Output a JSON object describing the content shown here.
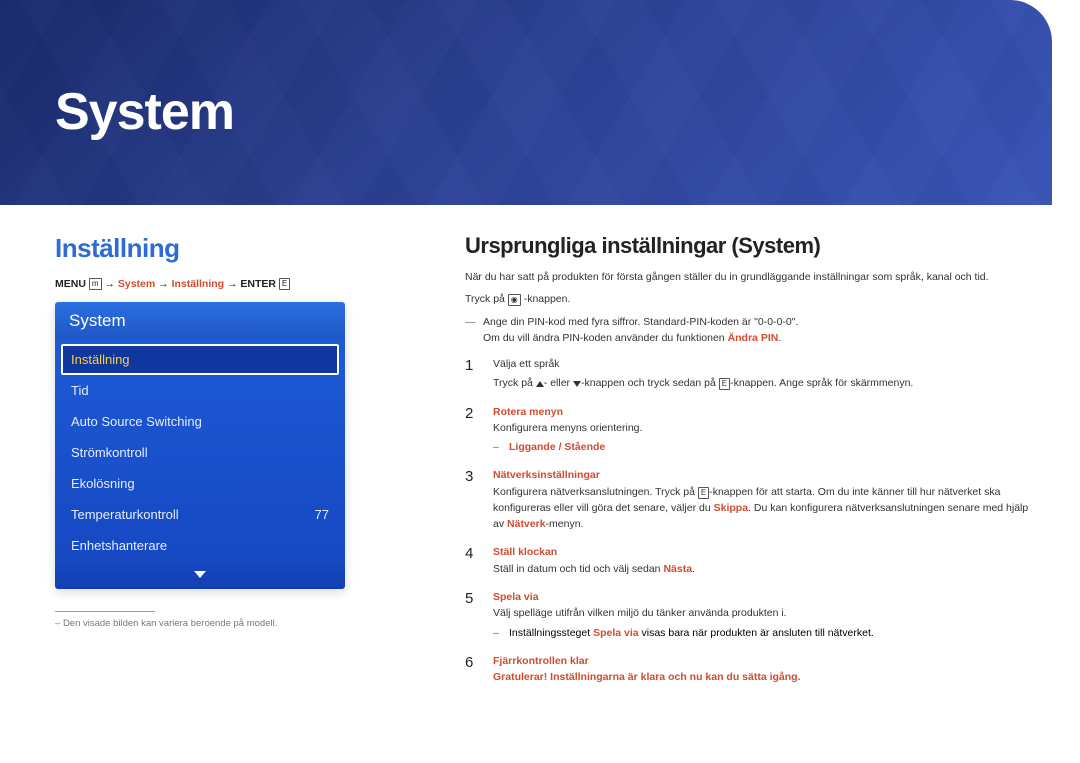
{
  "banner": {
    "title": "System"
  },
  "left": {
    "section_title": "Inställning",
    "breadcrumb": {
      "menu": "MENU",
      "arrow": "→",
      "p1": "System",
      "p2": "Inställning",
      "enter": "ENTER"
    },
    "menu": {
      "header": "System",
      "items": [
        {
          "label": "Inställning",
          "value": "",
          "selected": true
        },
        {
          "label": "Tid",
          "value": ""
        },
        {
          "label": "Auto Source Switching",
          "value": ""
        },
        {
          "label": "Strömkontroll",
          "value": ""
        },
        {
          "label": "Ekolösning",
          "value": ""
        },
        {
          "label": "Temperaturkontroll",
          "value": "77"
        },
        {
          "label": "Enhetshanterare",
          "value": ""
        }
      ]
    },
    "footnote_prefix": "–",
    "footnote": "Den visade bilden kan variera beroende på modell."
  },
  "right": {
    "title": "Ursprungliga inställningar (System)",
    "intro1": "När du har satt på produkten för första gången ställer du in grundläggande inställningar som språk, kanal och tid.",
    "intro2a": "Tryck på ",
    "intro2b": " -knappen.",
    "note1a": "Ange din PIN-kod med fyra siffror. Standard-PIN-koden är \"0-0-0-0\".",
    "note1b_pre": "Om du vill ändra PIN-koden använder du funktionen ",
    "note1b_hl": "Ändra PIN",
    "note1b_post": ".",
    "steps": {
      "s1": {
        "head": "Välja ett språk",
        "sub_a": "Tryck på ",
        "sub_b": "- eller ",
        "sub_c": "-knappen och tryck sedan på ",
        "sub_d": "-knappen. Ange språk för skärmmenyn."
      },
      "s2": {
        "head": "Rotera menyn",
        "sub": "Konfigurera menyns orientering.",
        "dash_hl": "Liggande / Stående"
      },
      "s3": {
        "head": "Nätverksinställningar",
        "sub_a": "Konfigurera nätverksanslutningen. Tryck på ",
        "sub_b": "-knappen för att starta. Om du inte känner till hur nätverket ska konfigureras eller vill göra det senare, väljer du ",
        "skip": "Skippa",
        "sub_c": ". Du kan konfigurera nätverksanslutningen senare med hjälp av ",
        "net": "Nätverk",
        "sub_d": "-menyn."
      },
      "s4": {
        "head": "Ställ klockan",
        "sub_a": "Ställ in datum och tid och välj sedan ",
        "nasta": "Nästa",
        "sub_b": "."
      },
      "s5": {
        "head": "Spela via",
        "sub": "Välj spelläge utifrån vilken miljö du tänker använda produkten i.",
        "dash_a": "Inställningssteget ",
        "dash_hl": "Spela via",
        "dash_b": " visas bara när produkten är ansluten till nätverket."
      },
      "s6": {
        "head": "Fjärrkontrollen klar",
        "sub": "Gratulerar! Inställningarna är klara och nu kan du sätta igång."
      }
    }
  }
}
